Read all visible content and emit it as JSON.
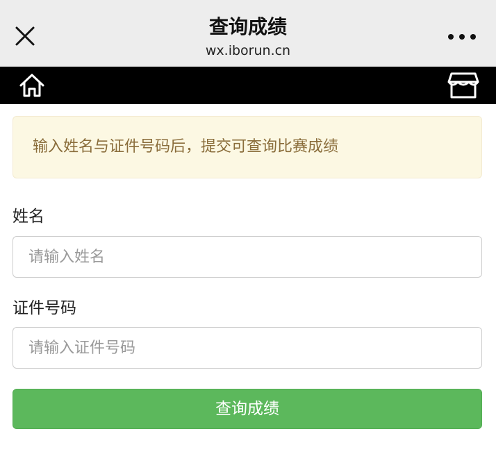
{
  "header": {
    "title": "查询成绩",
    "url": "wx.iborun.cn",
    "icons": {
      "close": "close-icon",
      "more": "more-icon"
    }
  },
  "navbar": {
    "icons": {
      "home": "home-icon",
      "shop": "store-icon"
    }
  },
  "notice": {
    "text": "输入姓名与证件号码后，提交可查询比赛成绩"
  },
  "form": {
    "name_label": "姓名",
    "name_placeholder": "请输入姓名",
    "name_value": "",
    "id_label": "证件号码",
    "id_placeholder": "请输入证件号码",
    "id_value": "",
    "submit_label": "查询成绩"
  },
  "colors": {
    "topbar_bg": "#ededed",
    "navbar_bg": "#000000",
    "notice_bg": "#fcf8e3",
    "notice_text": "#8a6d3b",
    "button_bg": "#5cb85c"
  }
}
